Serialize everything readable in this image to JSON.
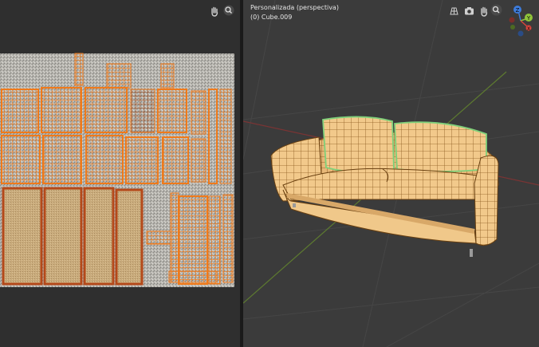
{
  "viewport": {
    "view_name": "Personalizada (perspectiva)",
    "object_name": "(0) Cube.009"
  },
  "navigation_gizmo": {
    "z_label": "Z",
    "y_label": "Y",
    "x_label": "X"
  },
  "icons": {
    "uv_pan": "hand-icon",
    "uv_zoom": "zoom-icon",
    "vp_grid": "grid-icon",
    "vp_camera": "camera-icon",
    "vp_pan": "hand-icon",
    "vp_zoom": "zoom-icon"
  },
  "colors": {
    "uv_islands": "#f07a1a",
    "mesh_fill": "#f2c98b",
    "selected_edge": "#7fd07a",
    "axis_x": "#d8453c",
    "axis_y": "#8fc43a",
    "axis_z": "#3d7cdc"
  }
}
